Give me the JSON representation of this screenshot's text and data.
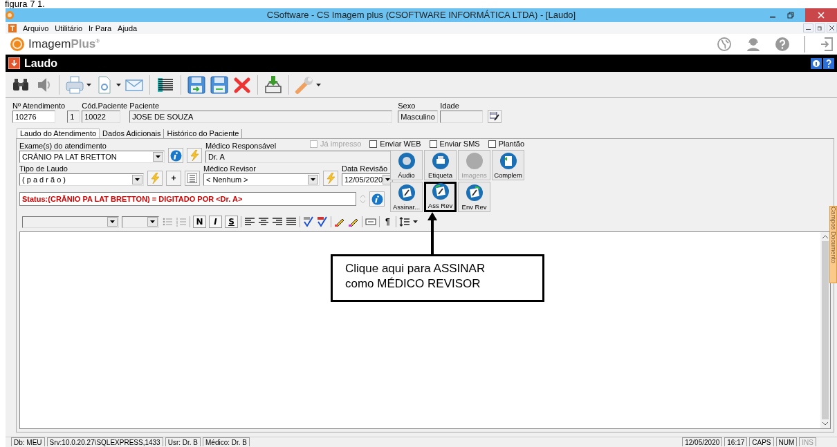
{
  "caption": "figura 7 1.",
  "window": {
    "title": "CSoftware - CS Imagem plus (CSOFTWARE INFORMÁTICA LTDA) - [Laudo]"
  },
  "menu": [
    {
      "label": "Arquivo"
    },
    {
      "label": "Utilitário"
    },
    {
      "label": "Ir Para"
    },
    {
      "label": "Ajuda"
    }
  ],
  "brand": {
    "name": "Imagem",
    "suffix": "Plus$^{®}$"
  },
  "form_title": "Laudo",
  "patient_fields": [
    {
      "label": "Nº Atendimento",
      "value": "10276",
      "kind": "input"
    },
    {
      "value": "1",
      "kind": "readonly"
    },
    {
      "label": "Cód.Paciente",
      "value": "10022",
      "kind": "readonly"
    },
    {
      "label": "Paciente",
      "value": "JOSE DE SOUZA",
      "kind": "readonly"
    },
    {
      "label": "Sexo",
      "value": "Masculino",
      "kind": "readonly"
    },
    {
      "label": "Idade",
      "kind": "readonly"
    }
  ],
  "tabs": [
    {
      "label": "Laudo do Atendimento",
      "selected": true
    },
    {
      "label": "Dados Adicionais",
      "selected": false
    },
    {
      "label": "Histórico do Paciente",
      "selected": false
    }
  ],
  "options": [
    {
      "label": "Já impresso",
      "checked": false,
      "disabled": true
    },
    {
      "label": "Enviar WEB",
      "checked": false,
      "disabled": false
    },
    {
      "label": "Enviar SMS",
      "checked": false,
      "disabled": false
    },
    {
      "label": "Plantão",
      "checked": false,
      "disabled": false
    }
  ],
  "exam": {
    "label": "Exame(s) do atendimento",
    "value": "CRÂNIO PA LAT BRETTON"
  },
  "responsible": {
    "label": "Médico Responsável",
    "value": "Dr. A"
  },
  "report_type": {
    "label": "Tipo de Laudo",
    "value": "( p a d r ã o )"
  },
  "add_button": "+",
  "reviewer": {
    "label": "Médico Revisor",
    "value": "< Nenhum >"
  },
  "review_date": {
    "label": "Data Revisão",
    "value": "12/05/2020"
  },
  "status": "Status:(CRÂNIO PA LAT BRETTON) = DIGITADO POR <Dr. A>",
  "actions": [
    {
      "label": "Áudio",
      "kind": "speaker",
      "disabled": false,
      "highlighted": false
    },
    {
      "label": "Etiqueta",
      "kind": "printer",
      "disabled": false,
      "highlighted": false
    },
    {
      "label": "Imagens",
      "kind": "blank",
      "disabled": true,
      "highlighted": false
    },
    {
      "label": "Complem",
      "kind": "document",
      "disabled": false,
      "highlighted": false
    },
    {
      "label": "Assinar...",
      "kind": "sign",
      "disabled": false,
      "highlighted": false
    },
    {
      "label": "Ass Rev",
      "kind": "sign-review",
      "disabled": false,
      "highlighted": true
    },
    {
      "label": "Env Rev",
      "kind": "sign-send",
      "disabled": false,
      "highlighted": false
    }
  ],
  "format_buttons": [
    {
      "label": "N",
      "kind": "bold"
    },
    {
      "label": "I",
      "kind": "italic"
    },
    {
      "label": "S",
      "kind": "underline"
    }
  ],
  "pilcrow": "¶",
  "side_tab": "Campos Documento",
  "callout": [
    "Clique aqui para ASSINAR",
    "como MÉDICO REVISOR"
  ],
  "status_bar": [
    {
      "text": "Db: MEU",
      "disabled": false
    },
    {
      "text": "Srv:10.0.20.27\\SQLEXPRESS,1433",
      "disabled": false
    },
    {
      "text": "Usr: Dr. B",
      "disabled": false
    },
    {
      "text": "Médico: Dr. B",
      "disabled": false
    },
    {
      "text": "12/05/2020",
      "disabled": false
    },
    {
      "text": "16:17",
      "disabled": false
    },
    {
      "text": "CAPS",
      "disabled": false
    },
    {
      "text": "NUM",
      "disabled": false
    },
    {
      "text": "INS",
      "disabled": true
    }
  ]
}
